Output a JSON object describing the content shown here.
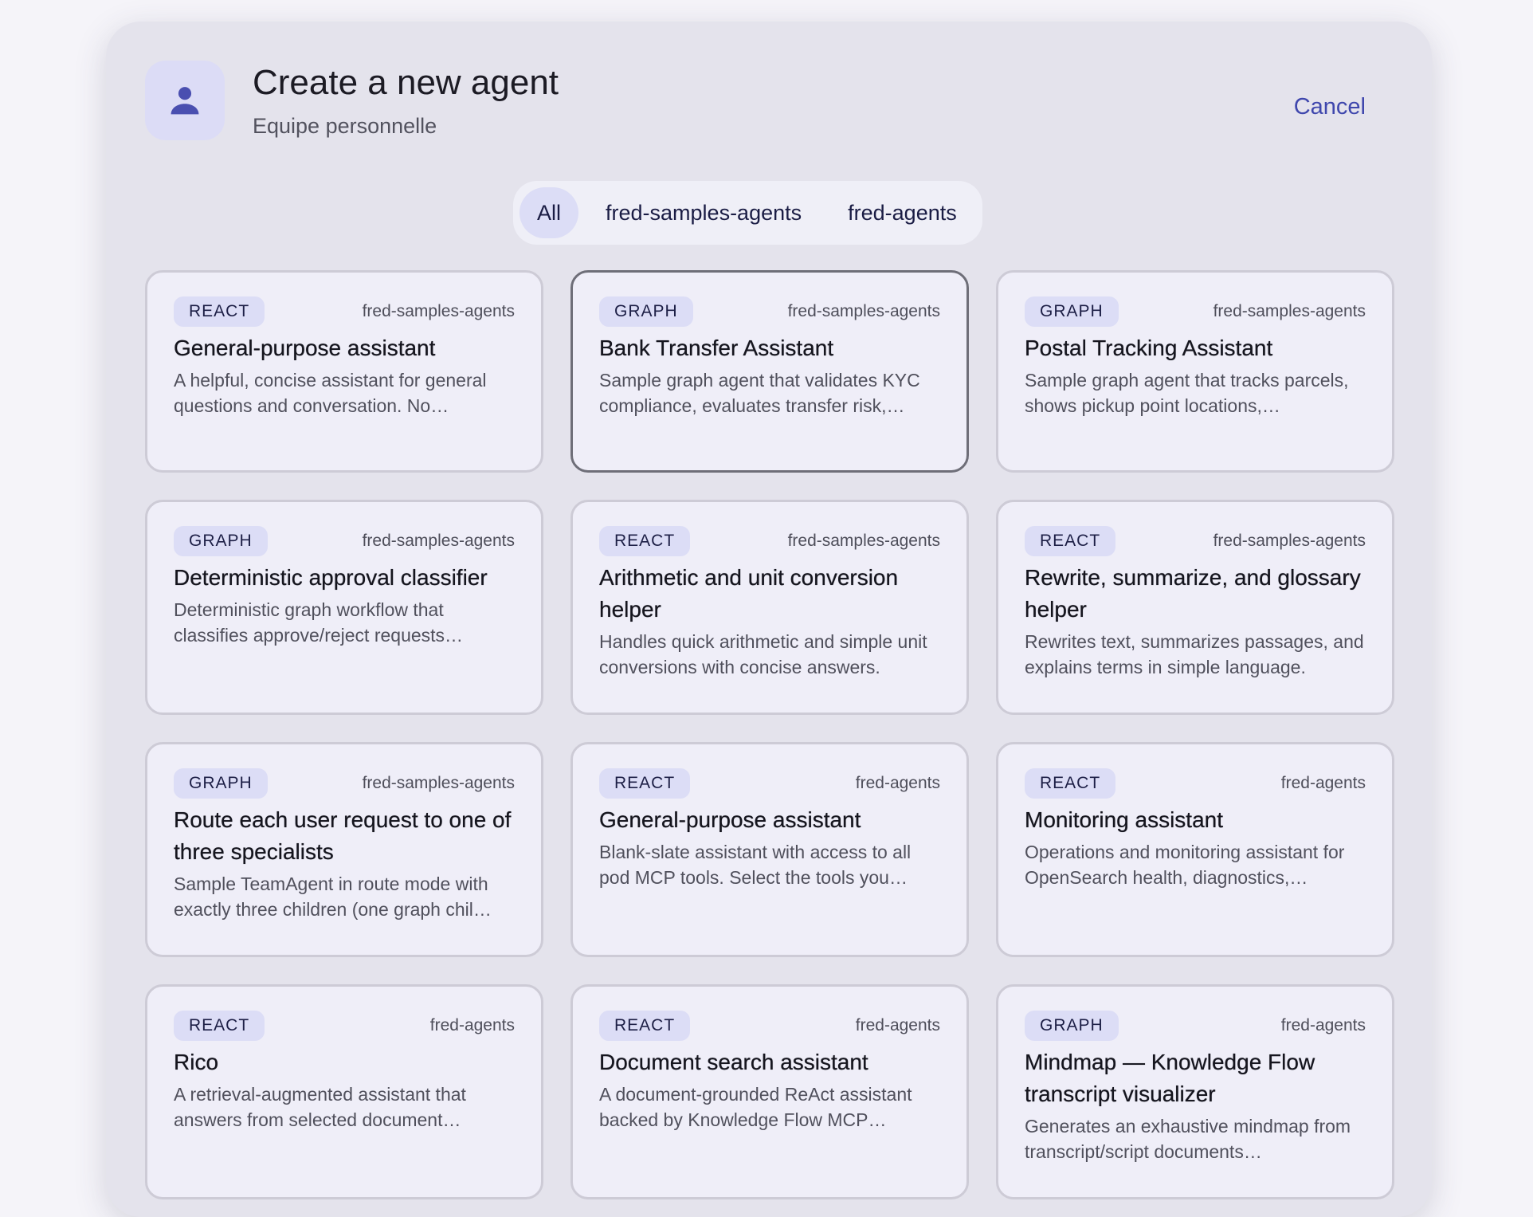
{
  "header": {
    "title": "Create a new agent",
    "subtitle": "Equipe personnelle",
    "cancel_label": "Cancel",
    "avatar_icon": "person-icon"
  },
  "filters": [
    "All",
    "fred-samples-agents",
    "fred-agents"
  ],
  "active_filter": "All",
  "colors": {
    "accent": "#3f47ad",
    "badge_bg": "#dcddf6",
    "card_bg": "#efeef8",
    "dialog_bg": "#e4e3ec"
  },
  "cards": [
    {
      "type": "REACT",
      "source": "fred-samples-agents",
      "title": "General-purpose assistant",
      "desc": "A helpful, concise assistant for general questions and conversation. No…"
    },
    {
      "type": "GRAPH",
      "source": "fred-samples-agents",
      "title": "Bank Transfer Assistant",
      "desc": "Sample graph agent that validates KYC compliance, evaluates transfer risk,…",
      "selected": true
    },
    {
      "type": "GRAPH",
      "source": "fred-samples-agents",
      "title": "Postal Tracking Assistant",
      "desc": "Sample graph agent that tracks parcels, shows pickup point locations,…"
    },
    {
      "type": "GRAPH",
      "source": "fred-samples-agents",
      "title": "Deterministic approval classifier",
      "desc": "Deterministic graph workflow that classifies approve/reject requests…"
    },
    {
      "type": "REACT",
      "source": "fred-samples-agents",
      "title": "Arithmetic and unit conversion helper",
      "desc": "Handles quick arithmetic and simple unit conversions with concise answers."
    },
    {
      "type": "REACT",
      "source": "fred-samples-agents",
      "title": "Rewrite, summarize, and glossary helper",
      "desc": "Rewrites text, summarizes passages, and explains terms in simple language."
    },
    {
      "type": "GRAPH",
      "source": "fred-samples-agents",
      "title": "Route each user request to one of three specialists",
      "desc": "Sample TeamAgent in route mode with exactly three children (one graph chil…"
    },
    {
      "type": "REACT",
      "source": "fred-agents",
      "title": "General-purpose assistant",
      "desc": "Blank-slate assistant with access to all pod MCP tools. Select the tools you…"
    },
    {
      "type": "REACT",
      "source": "fred-agents",
      "title": "Monitoring assistant",
      "desc": "Operations and monitoring assistant for OpenSearch health, diagnostics,…"
    },
    {
      "type": "REACT",
      "source": "fred-agents",
      "title": "Rico",
      "desc": "A retrieval-augmented assistant that answers from selected document…"
    },
    {
      "type": "REACT",
      "source": "fred-agents",
      "title": "Document search assistant",
      "desc": "A document-grounded ReAct assistant backed by Knowledge Flow MCP…"
    },
    {
      "type": "GRAPH",
      "source": "fred-agents",
      "title": "Mindmap — Knowledge Flow transcript visualizer",
      "desc": "Generates an exhaustive mindmap from transcript/script documents…"
    }
  ]
}
